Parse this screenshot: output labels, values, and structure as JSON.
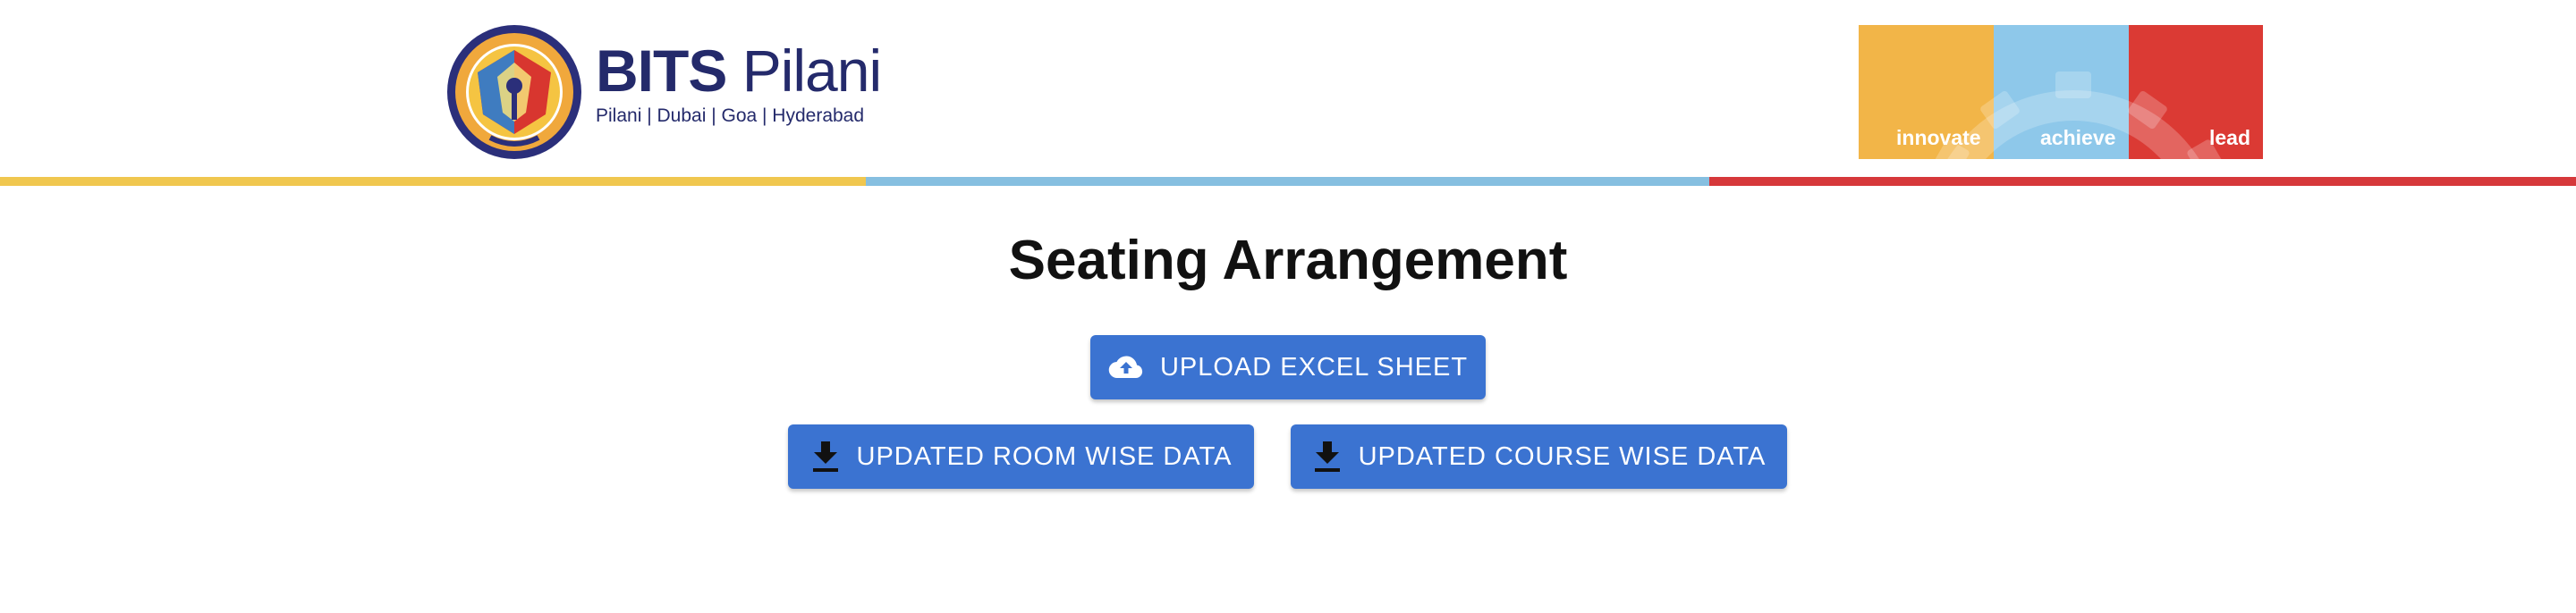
{
  "header": {
    "brand_bold": "BITS",
    "brand_regular": "Pilani",
    "campuses": "Pilani | Dubai | Goa | Hyderabad",
    "seal_icon": "bits-seal-logo",
    "tagline": [
      {
        "label": "innovate",
        "color": "#f2b548"
      },
      {
        "label": "achieve",
        "color": "#8ec8ea"
      },
      {
        "label": "lead",
        "color": "#db3a34"
      }
    ],
    "stripe_colors": [
      "#f0c74f",
      "#86bfe0",
      "#d6383a"
    ],
    "brand_color": "#242a6b"
  },
  "main": {
    "title": "Seating Arrangement",
    "upload_button": {
      "label": "UPLOAD EXCEL SHEET",
      "icon": "cloud-upload-icon"
    },
    "room_button": {
      "label": "UPDATED ROOM WISE DATA",
      "icon": "download-icon"
    },
    "course_button": {
      "label": "UPDATED COURSE WISE DATA",
      "icon": "download-icon"
    },
    "button_color": "#3b73d1"
  }
}
